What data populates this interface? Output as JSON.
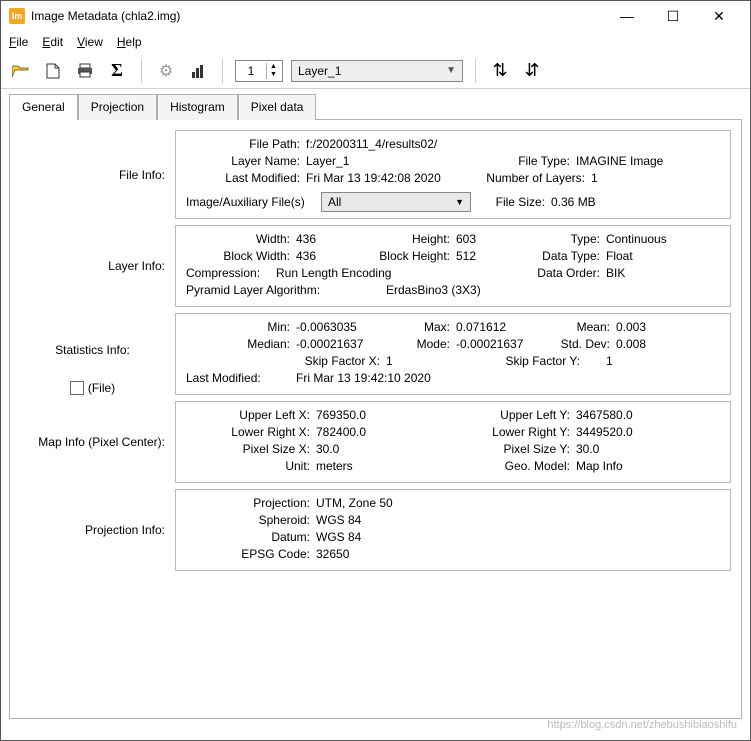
{
  "window": {
    "title": "Image Metadata (chla2.img)",
    "app_icon_text": "Im"
  },
  "menu": {
    "file": "File",
    "edit": "Edit",
    "view": "View",
    "help": "Help"
  },
  "toolbar": {
    "spin_value": "1",
    "layer_select": "Layer_1"
  },
  "tabs": {
    "t1": "General",
    "t2": "Projection",
    "t3": "Histogram",
    "t4": "Pixel data"
  },
  "labels": {
    "file_info": "File Info:",
    "layer_info": "Layer Info:",
    "stats_info": "Statistics Info:",
    "file_chk": "(File)",
    "map_info": "Map Info (Pixel Center):",
    "proj_info": "Projection Info:"
  },
  "file_info": {
    "file_path_k": "File Path:",
    "file_path_v": "f:/20200311_4/results02/",
    "layer_name_k": "Layer Name:",
    "layer_name_v": "Layer_1",
    "file_type_k": "File Type:",
    "file_type_v": "IMAGINE Image",
    "last_mod_k": "Last Modified:",
    "last_mod_v": "Fri Mar 13 19:42:08 2020",
    "num_layers_k": "Number of Layers:",
    "num_layers_v": "1",
    "aux_k": "Image/Auxiliary File(s)",
    "aux_v": "All",
    "file_size_k": "File Size:",
    "file_size_v": "0.36 MB"
  },
  "layer_info": {
    "width_k": "Width:",
    "width_v": "436",
    "height_k": "Height:",
    "height_v": "603",
    "type_k": "Type:",
    "type_v": "Continuous",
    "bwidth_k": "Block Width:",
    "bwidth_v": "436",
    "bheight_k": "Block Height:",
    "bheight_v": "512",
    "dtype_k": "Data Type:",
    "dtype_v": "Float",
    "comp_k": "Compression:",
    "comp_v": "Run Length Encoding",
    "dorder_k": "Data Order:",
    "dorder_v": "BIK",
    "pyr_k": "Pyramid Layer Algorithm:",
    "pyr_v": "ErdasBino3 (3X3)"
  },
  "stats": {
    "min_k": "Min:",
    "min_v": "-0.0063035",
    "max_k": "Max:",
    "max_v": "0.071612",
    "mean_k": "Mean:",
    "mean_v": "0.003",
    "median_k": "Median:",
    "median_v": "-0.00021637",
    "mode_k": "Mode:",
    "mode_v": "-0.00021637",
    "std_k": "Std. Dev:",
    "std_v": "0.008",
    "sfx_k": "Skip Factor X:",
    "sfx_v": "1",
    "sfy_k": "Skip Factor Y:",
    "sfy_v": "1",
    "lm_k": "Last Modified:",
    "lm_v": "Fri Mar 13 19:42:10 2020"
  },
  "map": {
    "ulx_k": "Upper Left X:",
    "ulx_v": "769350.0",
    "uly_k": "Upper Left Y:",
    "uly_v": "3467580.0",
    "lrx_k": "Lower Right X:",
    "lrx_v": "782400.0",
    "lry_k": "Lower Right Y:",
    "lry_v": "3449520.0",
    "psx_k": "Pixel Size X:",
    "psx_v": "30.0",
    "psy_k": "Pixel Size Y:",
    "psy_v": "30.0",
    "unit_k": "Unit:",
    "unit_v": "meters",
    "geo_k": "Geo. Model:",
    "geo_v": "Map Info"
  },
  "proj": {
    "proj_k": "Projection:",
    "proj_v": "UTM, Zone 50",
    "sph_k": "Spheroid:",
    "sph_v": "WGS 84",
    "datum_k": "Datum:",
    "datum_v": "WGS 84",
    "epsg_k": "EPSG Code:",
    "epsg_v": "32650"
  },
  "watermark": "https://blog.csdn.net/zhebushibiaoshifu"
}
